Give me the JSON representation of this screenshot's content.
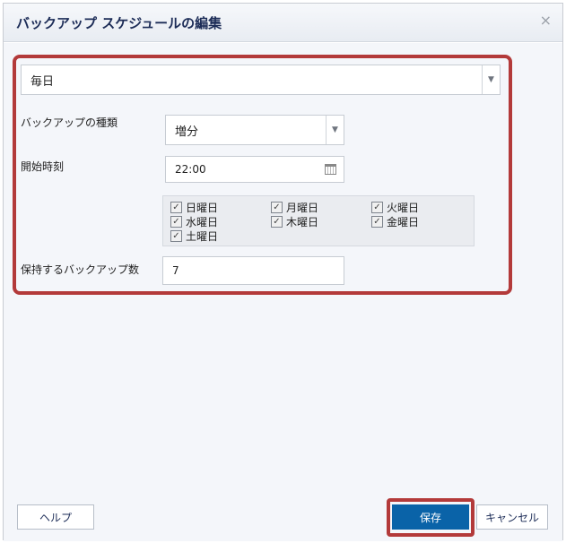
{
  "dialog": {
    "title": "バックアップ スケジュールの編集",
    "close_glyph": "×"
  },
  "frequency": {
    "value": "毎日"
  },
  "backup_type": {
    "label": "バックアップの種類",
    "value": "増分"
  },
  "start_time": {
    "label": "開始時刻",
    "value": "22:00"
  },
  "days": [
    {
      "label": "日曜日",
      "checked": true
    },
    {
      "label": "月曜日",
      "checked": true
    },
    {
      "label": "火曜日",
      "checked": true
    },
    {
      "label": "水曜日",
      "checked": true
    },
    {
      "label": "木曜日",
      "checked": true
    },
    {
      "label": "金曜日",
      "checked": true
    },
    {
      "label": "土曜日",
      "checked": true
    }
  ],
  "retain": {
    "label": "保持するバックアップ数",
    "value": "7"
  },
  "buttons": {
    "help": "ヘルプ",
    "save": "保存",
    "cancel": "キャンセル"
  },
  "colors": {
    "primary": "#0a63a8",
    "highlight": "#b33a3a",
    "title": "#1c2c57"
  }
}
